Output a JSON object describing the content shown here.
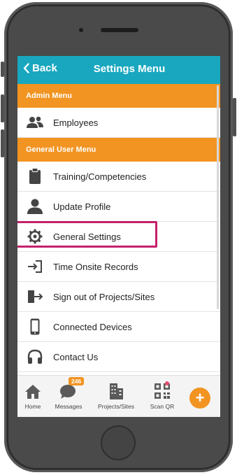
{
  "header": {
    "back_label": "Back",
    "title": "Settings Menu"
  },
  "sections": {
    "admin": "Admin Menu",
    "general": "General User Menu"
  },
  "menu": {
    "employees": "Employees",
    "training": "Training/Competencies",
    "update_profile": "Update Profile",
    "general_settings": "General Settings",
    "time_onsite": "Time Onsite Records",
    "sign_out": "Sign out of Projects/Sites",
    "connected_devices": "Connected Devices",
    "contact_us": "Contact Us"
  },
  "tabs": {
    "home": "Home",
    "messages": "Messages",
    "messages_badge": "246",
    "projects": "Projects/Sites",
    "scan": "Scan QR",
    "add": "+"
  },
  "colors": {
    "header": "#19a7bf",
    "section": "#f29422",
    "highlight": "#c5206a"
  },
  "icons": [
    "chevron-left-icon",
    "users-icon",
    "clipboard-icon",
    "person-icon",
    "gear-icon",
    "sign-in-icon",
    "sign-out-icon",
    "phone-icon",
    "headset-icon",
    "home-icon",
    "chat-icon",
    "buildings-icon",
    "qr-icon",
    "plus-icon"
  ]
}
